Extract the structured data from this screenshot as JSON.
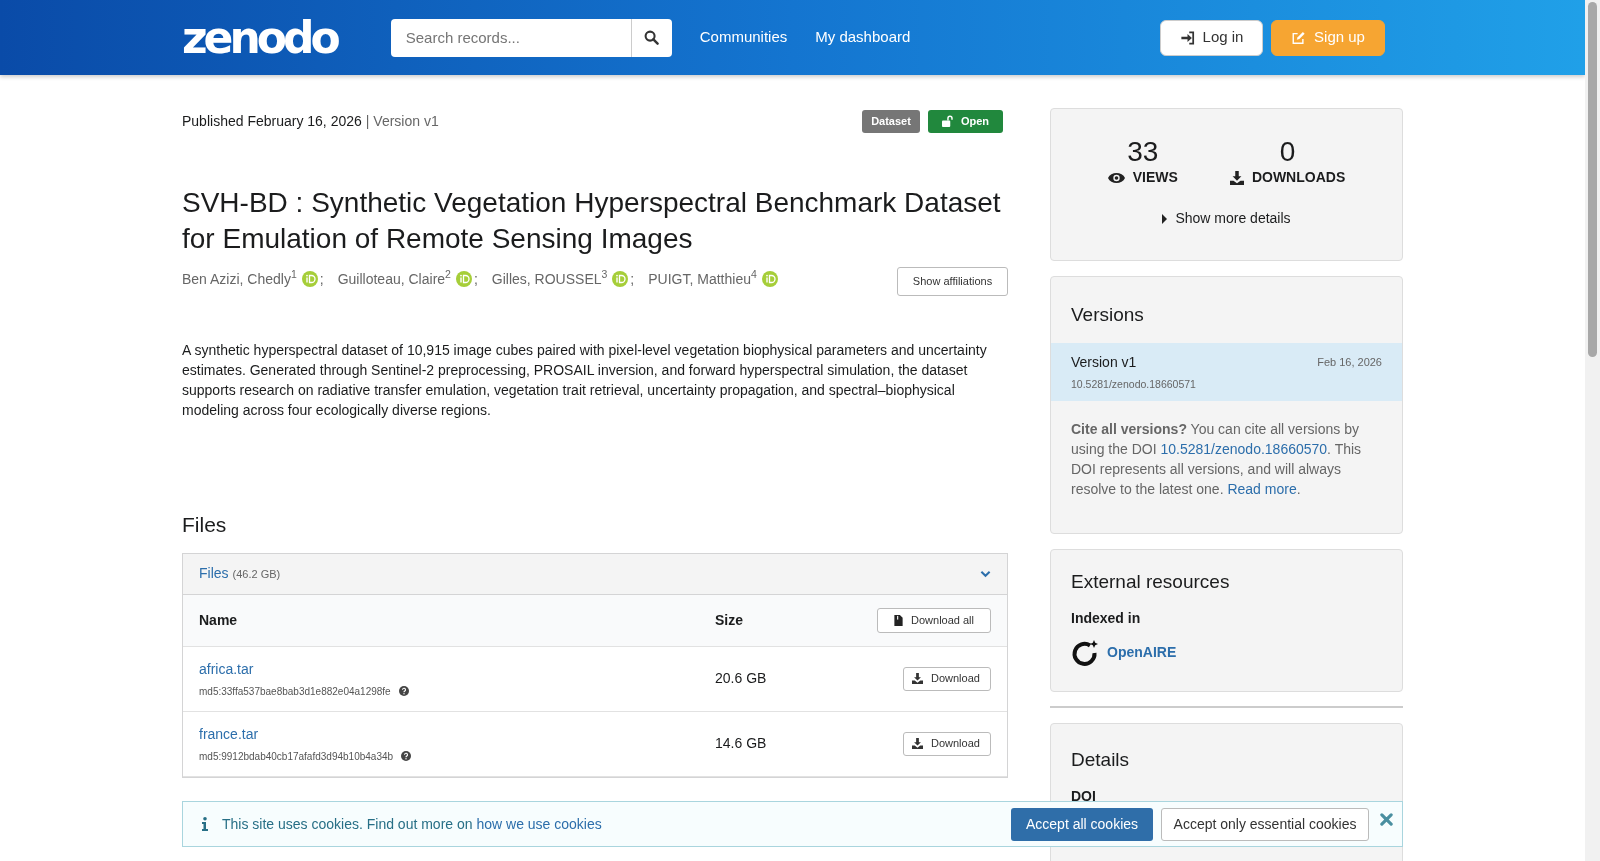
{
  "header": {
    "logo": "zenodo",
    "search": {
      "placeholder": "Search records..."
    },
    "nav": [
      "Communities",
      "My dashboard"
    ],
    "buttons": [
      {
        "label": "Log in",
        "kind": "login"
      },
      {
        "label": "Sign up",
        "kind": "signup"
      }
    ]
  },
  "record": {
    "published": "Published February 16, 2026",
    "version": "| Version v1",
    "badges": [
      {
        "label": "Dataset",
        "kind": "type"
      },
      {
        "label": "Open",
        "kind": "access"
      }
    ],
    "title": "SVH-BD : Synthetic Vegetation Hyperspectral Benchmark Dataset for Emulation of Remote Sensing Images",
    "creators": [
      {
        "name": "Ben Azizi, Chedly",
        "affiliation": "1"
      },
      {
        "name": "Guilloteau, Claire",
        "affiliation": "2"
      },
      {
        "name": "Gilles, ROUSSEL",
        "affiliation": "3"
      },
      {
        "name": "PUIGT, Matthieu",
        "affiliation": "4"
      }
    ],
    "separator": ";",
    "show_affiliations": "Show affiliations",
    "description": "A synthetic hyperspectral dataset of 10,915 image cubes paired with pixel-level vegetation biophysical parameters and uncertainty estimates. Generated through Sentinel-2 preprocessing, PROSAIL inversion, and forward hyperspectral simulation, the dataset supports research on radiative transfer emulation, vegetation trait retrieval, uncertainty propagation, and spectral–biophysical modeling across four ecologically diverse regions."
  },
  "files": {
    "heading": "Files",
    "panel": {
      "title": "Files",
      "total": "(46.2 GB)",
      "expanded": true
    },
    "columns": [
      "Name",
      "Size"
    ],
    "download_all": "Download all",
    "rows": [
      {
        "name": "africa.tar",
        "checksum": "md5:33ffa537bae8bab3d1e882e04a1298fe",
        "size": "20.6 GB",
        "action": "Download"
      },
      {
        "name": "france.tar",
        "checksum": "md5:9912bdab40cb17afafd3d94b10b4a34b",
        "size": "14.6 GB",
        "action": "Download"
      }
    ]
  },
  "stats": {
    "items": [
      {
        "value": "33",
        "label": "VIEWS",
        "kind": "views"
      },
      {
        "value": "0",
        "label": "DOWNLOADS",
        "kind": "downloads"
      }
    ],
    "more": {
      "label": "Show more details",
      "expanded": false
    }
  },
  "versions": {
    "title": "Versions",
    "items": [
      {
        "label": "Version v1",
        "date": "Feb 16, 2026",
        "doi": "10.5281/zenodo.18660571",
        "selected": true
      }
    ],
    "cite": [
      {
        "kind": "text",
        "text": "**Cite all versions?** You can cite all versions by using the DOI "
      },
      {
        "kind": "link",
        "text": "10.5281/zenodo.18660570"
      },
      {
        "kind": "text",
        "text": ". This DOI represents all versions, and will always resolve to the latest one. "
      },
      {
        "kind": "link",
        "text": "Read more"
      },
      {
        "kind": "text",
        "text": "."
      }
    ]
  },
  "external": {
    "title": "External resources",
    "subtitle": "Indexed in",
    "link": "OpenAIRE"
  },
  "details": {
    "title": "Details",
    "fields": [
      "DOI"
    ]
  },
  "cookie_banner": {
    "text": "This site uses cookies. Find out more on ",
    "link": "how we use cookies",
    "buttons": [
      {
        "label": "Accept all cookies",
        "kind": "primary"
      },
      {
        "label": "Accept only essential cookies",
        "kind": "secondary"
      }
    ]
  }
}
